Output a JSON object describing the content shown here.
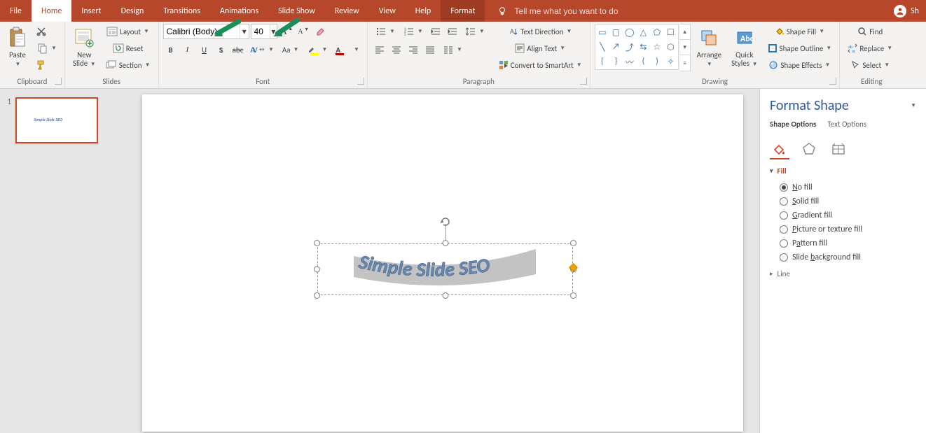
{
  "tabs": {
    "file": "File",
    "home": "Home",
    "insert": "Insert",
    "design": "Design",
    "transitions": "Transitions",
    "animations": "Animations",
    "slideshow": "Slide Show",
    "review": "Review",
    "view": "View",
    "help": "Help",
    "format": "Format",
    "tellme": "Tell me what you want to do"
  },
  "account": {
    "initials": "Sh"
  },
  "groups": {
    "clipboard": "Clipboard",
    "slides": "Slides",
    "font": "Font",
    "paragraph": "Paragraph",
    "drawing": "Drawing",
    "editing": "Editing"
  },
  "clipboard": {
    "paste": "Paste"
  },
  "slides": {
    "newslide_l1": "New",
    "newslide_l2": "Slide",
    "layout": "Layout",
    "reset": "Reset",
    "section": "Section"
  },
  "font": {
    "name": "Calibri (Body)",
    "size": "40"
  },
  "paragraph": {
    "textdir": "Text Direction",
    "align": "Align Text",
    "smart": "Convert to SmartArt"
  },
  "drawing": {
    "arrange": "Arrange",
    "styles_l1": "Quick",
    "styles_l2": "Styles",
    "shapefill": "Shape Fill",
    "shapeoutline": "Shape Outline",
    "shapeeffects": "Shape Effects"
  },
  "editing": {
    "find": "Find",
    "replace": "Replace",
    "select": "Select"
  },
  "thumb": {
    "num": "1"
  },
  "wordart_text": "Simple Slide SEO",
  "pane": {
    "title": "Format Shape",
    "tab_shape": "Shape Options",
    "tab_text": "Text Options",
    "sec_fill": "Fill",
    "sec_line": "Line",
    "fill_options": [
      {
        "key": "nofill",
        "pre": "",
        "u": "N",
        "post": "o fill",
        "checked": true
      },
      {
        "key": "solid",
        "pre": "",
        "u": "S",
        "post": "olid fill",
        "checked": false
      },
      {
        "key": "gradient",
        "pre": "",
        "u": "G",
        "post": "radient fill",
        "checked": false
      },
      {
        "key": "picture",
        "pre": "",
        "u": "P",
        "post": "icture or texture fill",
        "checked": false
      },
      {
        "key": "pattern",
        "pre": "P",
        "u": "a",
        "post": "ttern fill",
        "checked": false
      },
      {
        "key": "slidebg",
        "pre": "Slide ",
        "u": "b",
        "post": "ackground fill",
        "checked": false
      }
    ]
  }
}
